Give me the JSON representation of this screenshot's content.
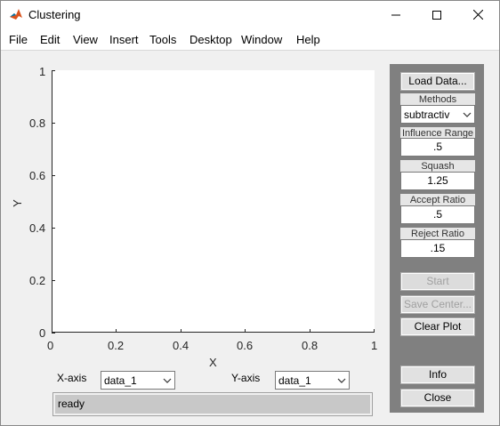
{
  "window": {
    "title": "Clustering",
    "icon": "matlab-icon"
  },
  "menu": [
    "File",
    "Edit",
    "View",
    "Insert",
    "Tools",
    "Desktop",
    "Window",
    "Help"
  ],
  "axes": {
    "xlabel": "X",
    "ylabel": "Y",
    "xlim": [
      0,
      1
    ],
    "ylim": [
      0,
      1
    ],
    "xticks": [
      "0",
      "0.2",
      "0.4",
      "0.6",
      "0.8",
      "1"
    ],
    "yticks": [
      "0",
      "0.2",
      "0.4",
      "0.6",
      "0.8",
      "1"
    ]
  },
  "controls": {
    "xaxis_label": "X-axis",
    "xaxis_value": "data_1",
    "yaxis_label": "Y-axis",
    "yaxis_value": "data_1",
    "status": "ready"
  },
  "panel": {
    "load_data": "Load Data...",
    "methods_label": "Methods",
    "methods_value": "subtractiv",
    "influence_label": "Influence Range",
    "influence_value": ".5",
    "squash_label": "Squash",
    "squash_value": "1.25",
    "accept_label": "Accept Ratio",
    "accept_value": ".5",
    "reject_label": "Reject Ratio",
    "reject_value": ".15",
    "start": "Start",
    "save_center": "Save Center...",
    "clear_plot": "Clear Plot",
    "info": "Info",
    "close": "Close"
  }
}
